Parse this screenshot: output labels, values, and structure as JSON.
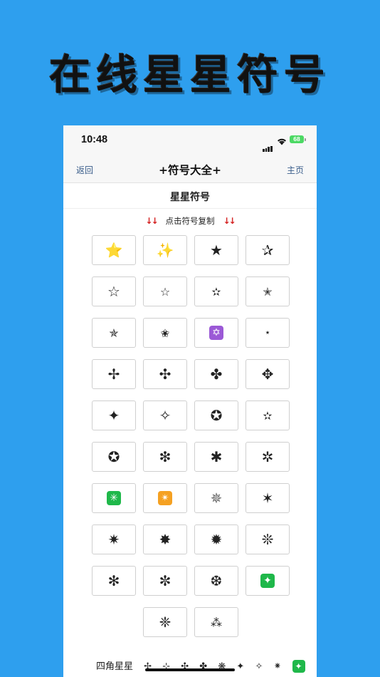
{
  "banner": {
    "title": "在线星星符号"
  },
  "status": {
    "time": "10:48",
    "battery": "68"
  },
  "nav": {
    "back": "返回",
    "title": "+符号大全+",
    "home": "主页"
  },
  "section": {
    "title": "星星符号",
    "hint": "点击符号复制",
    "arrow": "↓↓"
  },
  "symbols": [
    "⭐",
    "✨",
    "★",
    "✰",
    "☆",
    "☆",
    "✫",
    "✭",
    "✯",
    "✬",
    "✡",
    "⋆",
    "✢",
    "✣",
    "✤",
    "✥",
    "✦",
    "✧",
    "✪",
    "✫",
    "✪",
    "❇",
    "✱",
    "✲",
    "✳",
    "✴",
    "✵",
    "✶",
    "✷",
    "✸",
    "✹",
    "❊",
    "✻",
    "✼",
    "❆",
    "✦",
    "❈",
    "⁂"
  ],
  "colors": {
    "green_box": "#1fb84a",
    "orange_box": "#f5a122",
    "purple_box": "#9b59d6",
    "accent_red": "#d42020",
    "nav_link": "#3a5d8a"
  },
  "footer": {
    "label": "四角星星",
    "symbols": [
      "✢",
      "⊹",
      "✣",
      "✤",
      "❋",
      "✦",
      "✧",
      "⁕",
      "✦"
    ]
  }
}
